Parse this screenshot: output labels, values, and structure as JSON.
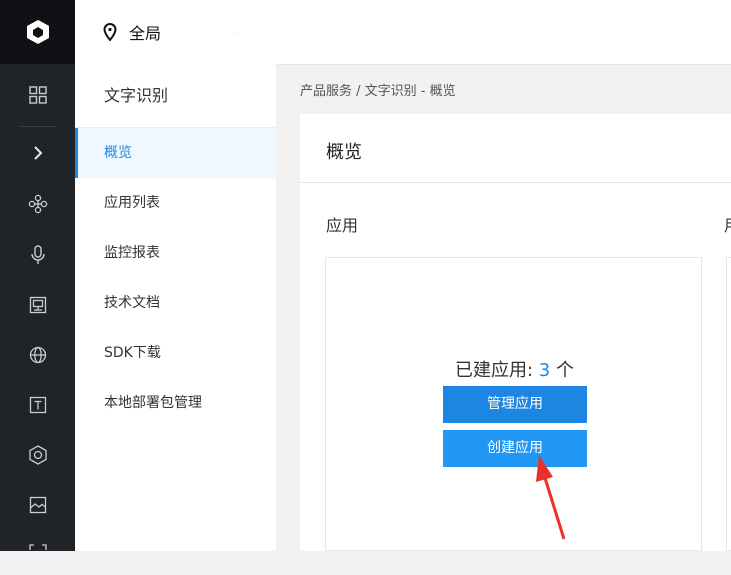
{
  "topbar": {
    "region_label": "全局",
    "icons": {
      "location": "location-pin-icon",
      "caret": "chevron-down-icon"
    }
  },
  "rail": {
    "icons": [
      "logo-icon",
      "grid-icon",
      "chevron-right-icon",
      "nodes-icon",
      "mic-icon",
      "board-icon",
      "globe-icon",
      "text-icon",
      "hexagon-icon",
      "image-icon"
    ]
  },
  "sidebar": {
    "title": "文字识别",
    "items": [
      {
        "label": "概览",
        "active": true
      },
      {
        "label": "应用列表"
      },
      {
        "label": "监控报表"
      },
      {
        "label": "技术文档"
      },
      {
        "label": "SDK下载"
      },
      {
        "label": "本地部署包管理"
      }
    ]
  },
  "breadcrumb": "产品服务 / 文字识别 - 概览",
  "page": {
    "title": "概览",
    "section_label": "应用",
    "section_label_2": "用",
    "stat_prefix": "已建应用: ",
    "stat_count": "3",
    "stat_suffix": " 个",
    "manage_button": "管理应用",
    "create_button": "创建应用"
  },
  "colors": {
    "accent": "#1e88e5",
    "rail_bg": "#202428",
    "arrow": "#e8312a"
  }
}
